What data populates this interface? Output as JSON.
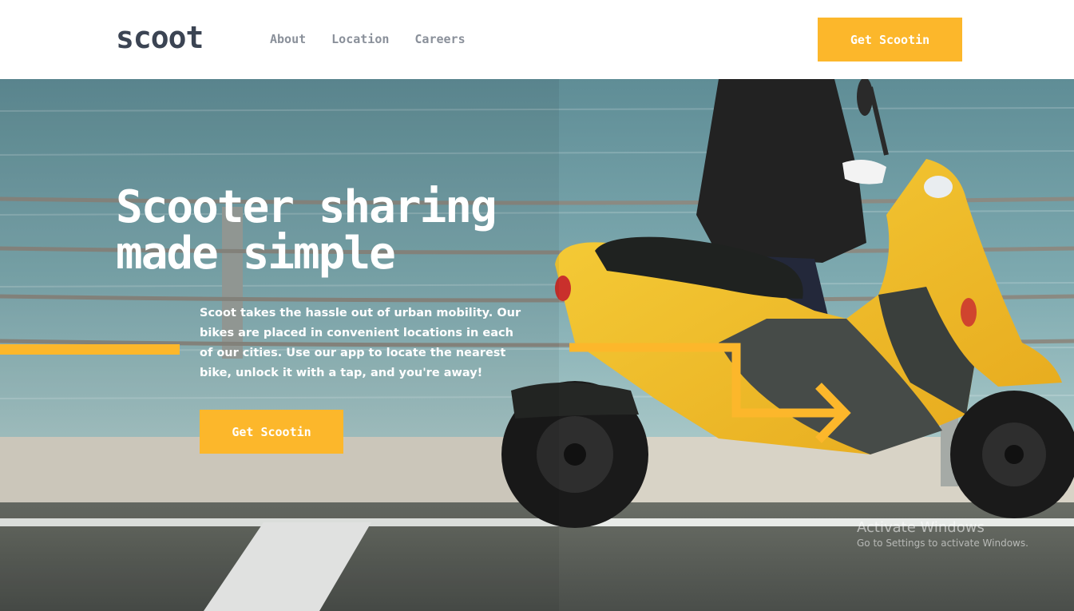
{
  "header": {
    "logo": "scoot",
    "nav": [
      "About",
      "Location",
      "Careers"
    ],
    "cta_label": "Get Scootin"
  },
  "hero": {
    "title_line1": "Scooter sharing",
    "title_line2": "made simple",
    "body": "Scoot takes the hassle out of urban mobility. Our bikes are placed in convenient locations in each of our cities. Use our app to locate the nearest bike, unlock it with a tap, and you're away!",
    "cta_label": "Get Scootin",
    "image_subject": "rider on yellow scooter by the sea"
  },
  "watermark": {
    "title": "Activate Windows",
    "subtitle": "Go to Settings to activate Windows."
  },
  "colors": {
    "accent": "#fcb72b",
    "logo": "#3b4453",
    "nav_text": "#8a909a",
    "sea": "#6f9fa6",
    "road": "#555a55"
  }
}
